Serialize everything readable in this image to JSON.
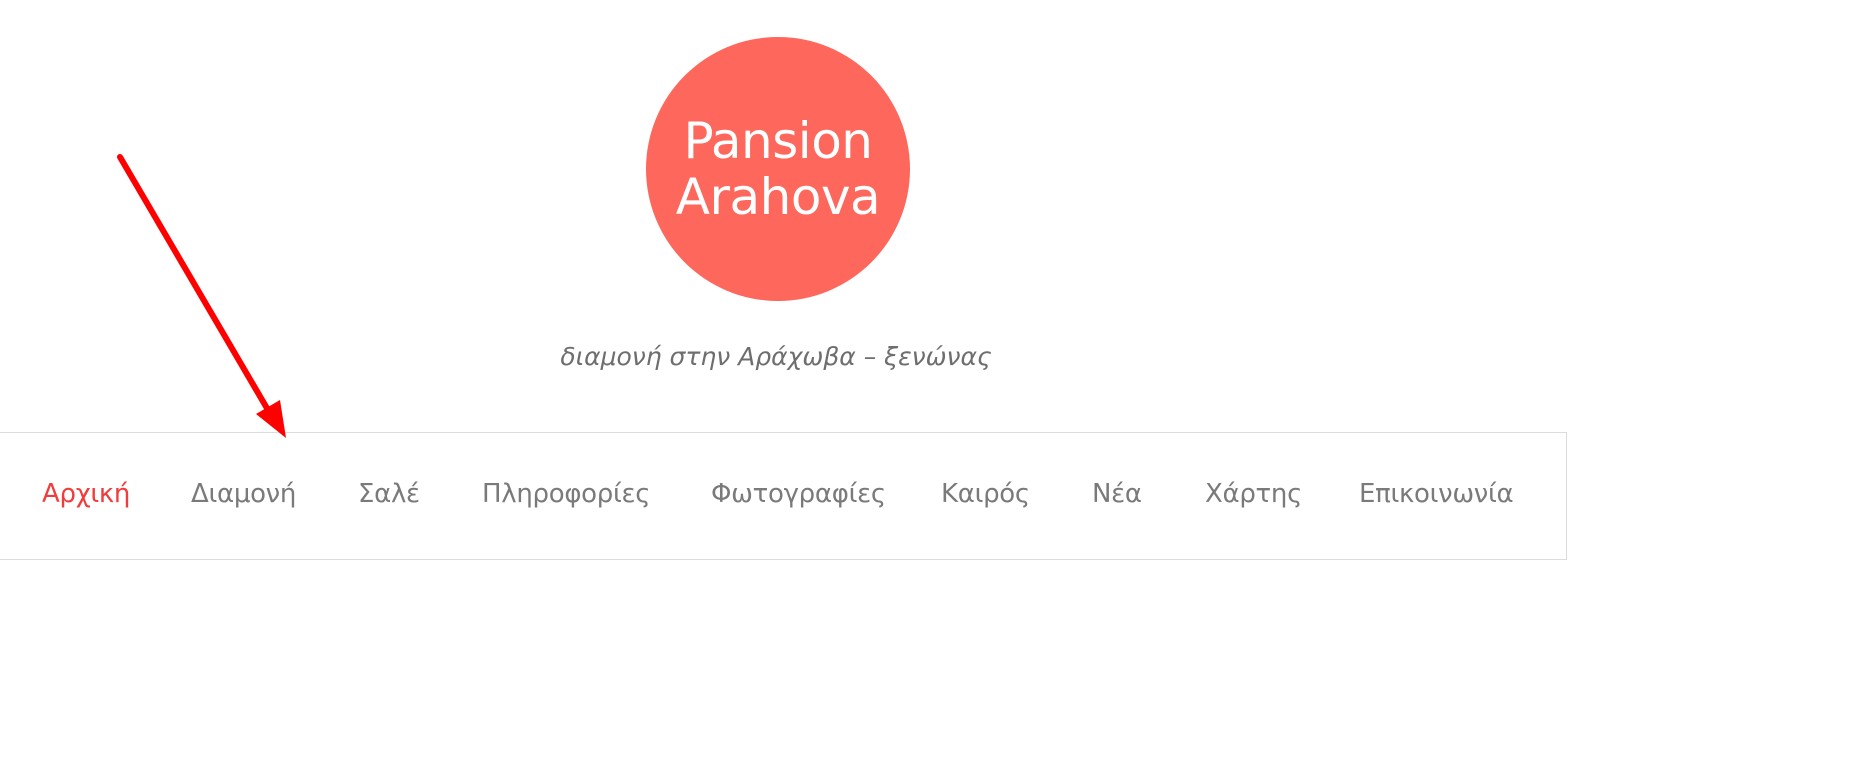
{
  "logo": {
    "line1": "Pansion",
    "line2": "Arahova",
    "color": "#fe675c"
  },
  "tagline": "διαμονή στην Αράχωβα – ξενώνας",
  "nav": {
    "items": [
      {
        "label": "Αρχική",
        "active": true
      },
      {
        "label": "Διαμονή",
        "active": false
      },
      {
        "label": "Σαλέ",
        "active": false
      },
      {
        "label": "Πληροφορίες",
        "active": false
      },
      {
        "label": "Φωτογραφίες",
        "active": false
      },
      {
        "label": "Καιρός",
        "active": false
      },
      {
        "label": "Νέα",
        "active": false
      },
      {
        "label": "Χάρτης",
        "active": false
      },
      {
        "label": "Επικοινωνία",
        "active": false
      }
    ],
    "active_color": "#f23b3b",
    "text_color": "#7a7a7a"
  },
  "annotation": {
    "arrow_color": "#ff0000",
    "target": "Διαμονή"
  }
}
